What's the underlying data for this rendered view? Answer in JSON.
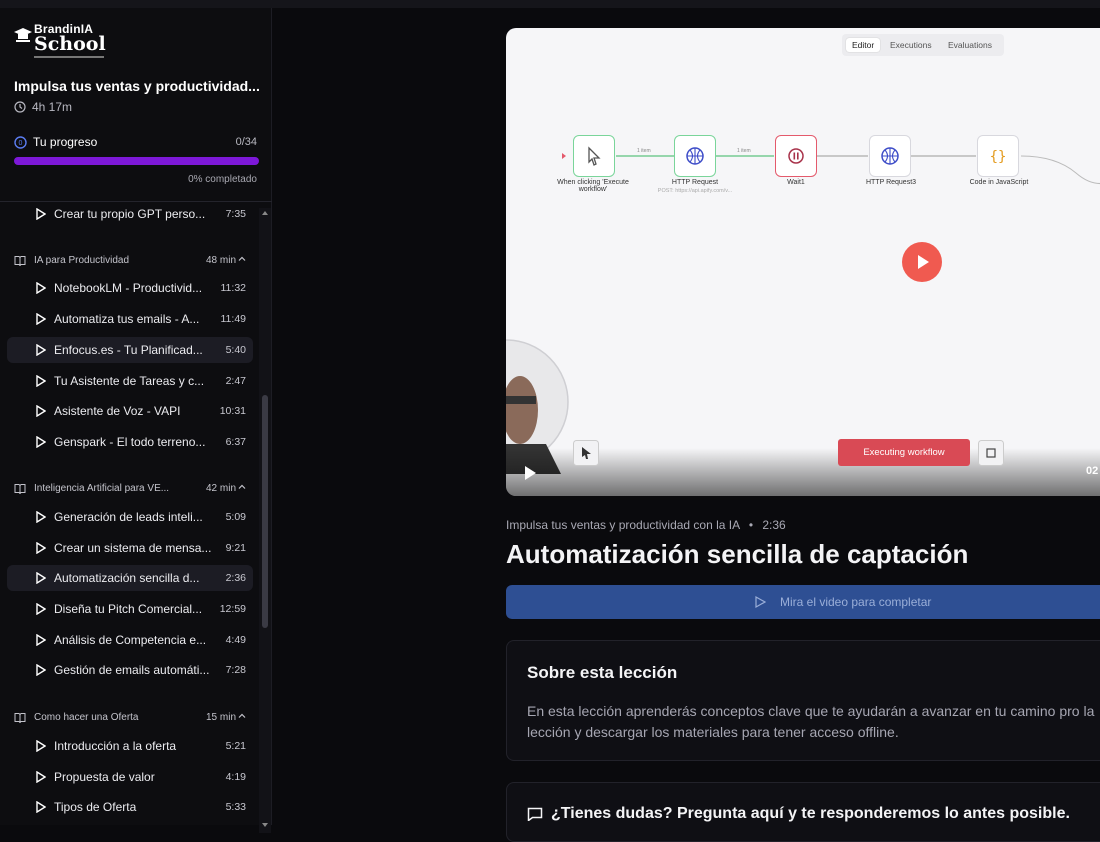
{
  "brand": {
    "line1": "BrandinIA",
    "line2": "School"
  },
  "course": {
    "title": "Impulsa tus ventas y productividad...",
    "duration": "4h 17m",
    "progress_label": "Tu progreso",
    "progress_count": "0/34",
    "progress_fraction": 0.0,
    "progress_pct_text": "0% completado"
  },
  "sidebar": {
    "lessons_top": [
      {
        "title": "Crear tu propio GPT perso...",
        "duration": "7:35"
      }
    ],
    "sections": [
      {
        "title": "IA para Productividad",
        "duration": "48 min",
        "lessons": [
          {
            "title": "NotebookLM - Productivid...",
            "duration": "11:32"
          },
          {
            "title": "Automatiza tus emails - A...",
            "duration": "11:49"
          },
          {
            "title": "Enfocus.es - Tu Planificad...",
            "duration": "5:40"
          },
          {
            "title": "Tu Asistente de Tareas y c...",
            "duration": "2:47"
          },
          {
            "title": "Asistente de Voz - VAPI",
            "duration": "10:31"
          },
          {
            "title": "Genspark - El todo terreno...",
            "duration": "6:37"
          }
        ]
      },
      {
        "title": "Inteligencia Artificial para VE...",
        "duration": "42 min",
        "lessons": [
          {
            "title": "Generación de leads inteli...",
            "duration": "5:09"
          },
          {
            "title": "Crear un sistema de mensa...",
            "duration": "9:21"
          },
          {
            "title": "Automatización sencilla d...",
            "duration": "2:36"
          },
          {
            "title": "Diseña tu Pitch Comercial...",
            "duration": "12:59"
          },
          {
            "title": "Análisis de Competencia e...",
            "duration": "4:49"
          },
          {
            "title": "Gestión de emails automáti...",
            "duration": "7:28"
          }
        ]
      },
      {
        "title": "Como hacer una Oferta",
        "duration": "15 min",
        "lessons": [
          {
            "title": "Introducción a la oferta",
            "duration": "5:21"
          },
          {
            "title": "Propuesta de valor",
            "duration": "4:19"
          },
          {
            "title": "Tipos de Oferta",
            "duration": "5:33"
          }
        ]
      }
    ]
  },
  "video": {
    "tabs": [
      "Editor",
      "Executions",
      "Evaluations"
    ],
    "nodes": [
      "When clicking 'Execute workflow'",
      "HTTP Request",
      "Wait1",
      "HTTP Request3",
      "Code in JavaScript"
    ],
    "edge_labels": [
      "1 item",
      "1 item"
    ],
    "node_sub": "POST: https://api.apify.com/v...",
    "executing_label": "Executing workflow",
    "time": "02"
  },
  "lesson": {
    "course_name": "Impulsa tus ventas y productividad con la IA",
    "duration": "2:36",
    "title": "Automatización sencilla de captación",
    "complete_label": "Mira el video para completar"
  },
  "about": {
    "heading": "Sobre esta lección",
    "body": "En esta lección aprenderás conceptos clave que te ayudarán a avanzar en tu camino pro la lección y descargar los materiales para tener acceso offline."
  },
  "qa": {
    "heading": "¿Tienes dudas? Pregunta aquí y te responderemos lo antes posible."
  },
  "colors": {
    "accent": "#9d2cf0",
    "primary_button": "#2e4f93",
    "play_button": "#f05a50"
  }
}
